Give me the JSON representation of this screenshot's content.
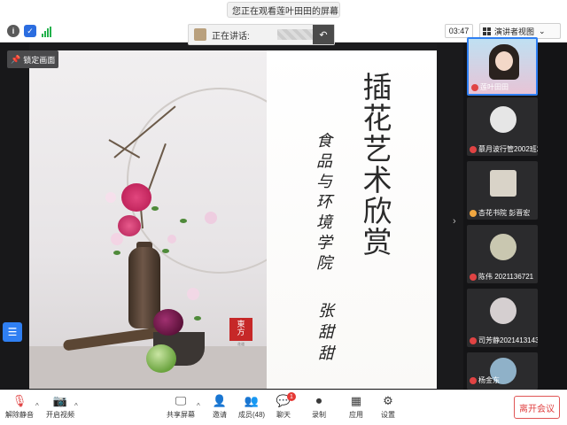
{
  "window": {
    "share_title": "您正在观看莲叶田田的屏幕",
    "share_title_chevron": "chevron-down-icon"
  },
  "toolbar": {
    "timer": "03:47",
    "view_button": "演讲者视图",
    "view_chevron": "chevron-down-icon"
  },
  "speaking": {
    "label": "正在讲话:"
  },
  "lock_screen": {
    "label": "锁定画面"
  },
  "slide": {
    "title": "插花艺术欣赏",
    "school": "食品与环境学院",
    "author": "张甜甜",
    "seal_text_top": "東",
    "seal_text_bottom": "方",
    "seal_side": "東方",
    "seal_sub": "花道"
  },
  "participants": [
    {
      "name": "莲叶田田",
      "active": true
    },
    {
      "name": "慕月波行管2002班20205..."
    },
    {
      "name": "杏花书院 彭晋宏"
    },
    {
      "name": "陈伟 2021136721"
    },
    {
      "name": "司芳静2021413143"
    },
    {
      "name": "杨金东"
    }
  ],
  "bottombar": {
    "unmute": "解除静音",
    "start_video": "开启视频",
    "share_screen": "共享屏幕",
    "invite": "邀请",
    "members": "成员(48)",
    "chat": "聊天",
    "chat_badge": "1",
    "record": "录制",
    "apps": "应用",
    "settings": "设置",
    "leave": "离开会议"
  }
}
